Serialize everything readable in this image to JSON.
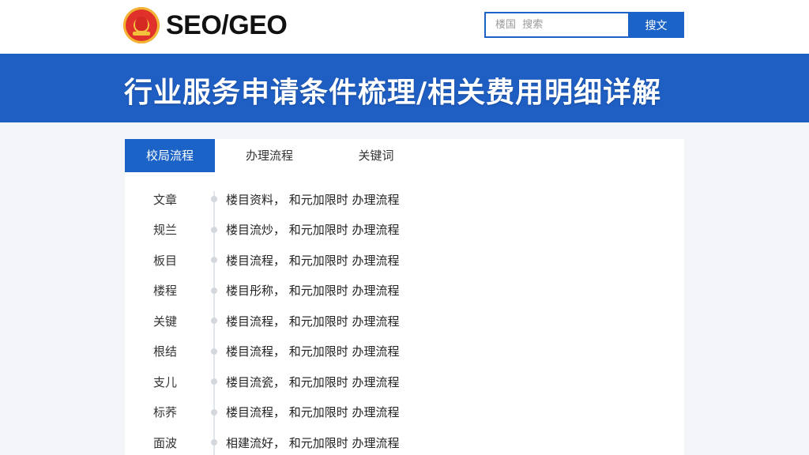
{
  "header": {
    "logo_text": "SEO/GEO",
    "search_placeholder": "楼国  搜索",
    "search_button": "搜文"
  },
  "banner": {
    "title": "行业服务申请条件梳理/相关费用明细详解"
  },
  "tabs": [
    {
      "label": "校局流程",
      "active": true
    },
    {
      "label": "办理流程",
      "active": false
    },
    {
      "label": "关键词",
      "active": false
    }
  ],
  "rows": [
    {
      "label": "文章",
      "desc": "楼目资料，  和元加限时 办理流程"
    },
    {
      "label": "规兰",
      "desc": "楼目流炒，  和元加限时 办理流程"
    },
    {
      "label": "板目",
      "desc": "楼目流程，  和元加限时 办理流程"
    },
    {
      "label": "楼程",
      "desc": "楼目彤称，  和元加限时 办理流程"
    },
    {
      "label": "关键",
      "desc": "楼目流程，  和元加限时 办理流程"
    },
    {
      "label": "根结",
      "desc": "楼目流程，  和元加限时 办理流程"
    },
    {
      "label": "支儿",
      "desc": "楼目流瓷，  和元加限时 办理流程"
    },
    {
      "label": "标荞",
      "desc": "楼目流程，  和元加限时 办理流程"
    },
    {
      "label": "面波",
      "desc": "相建流好，  和元加限时 办理流程"
    }
  ],
  "colors": {
    "brand_blue": "#1b63c6",
    "banner_blue": "#1f5fc4",
    "emblem_red": "#e0322a",
    "emblem_gold": "#f6c343"
  },
  "icons": {
    "logo": "national-emblem-icon"
  }
}
